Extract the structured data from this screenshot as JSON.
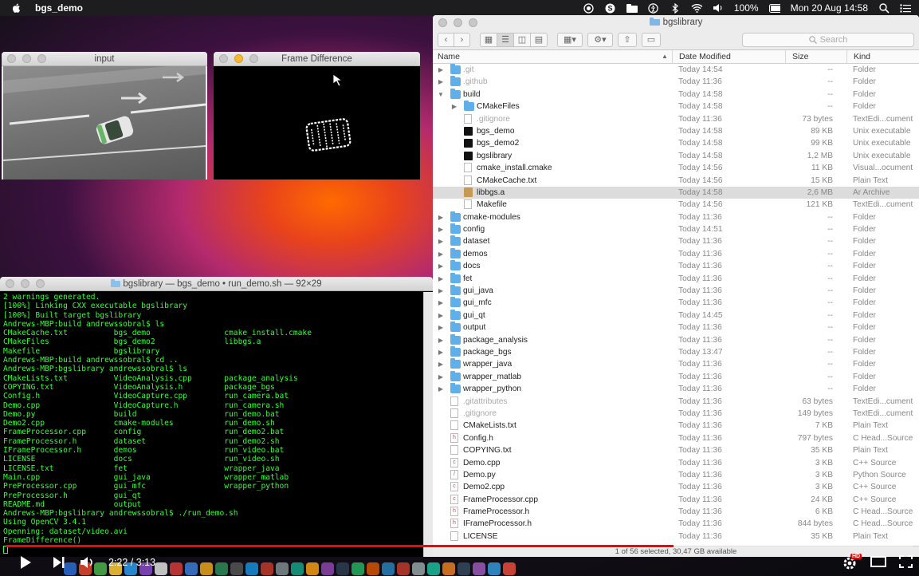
{
  "menubar": {
    "app_name": "bgs_demo",
    "battery": "100%",
    "datetime": "Mon 20 Aug  14:58"
  },
  "input_window": {
    "title": "input"
  },
  "frame_window": {
    "title": "Frame Difference"
  },
  "terminal": {
    "title": "bgslibrary — bgs_demo • run_demo.sh — 92×29",
    "lines": [
      "2 warnings generated.",
      "[100%] Linking CXX executable bgslibrary",
      "[100%] Built target bgslibrary",
      "Andrews-MBP:build andrewssobral$ ls",
      "CMakeCache.txt          bgs_demo                cmake_install.cmake",
      "CMakeFiles              bgs_demo2               libbgs.a",
      "Makefile                bgslibrary",
      "Andrews-MBP:build andrewssobral$ cd ..",
      "Andrews-MBP:bgslibrary andrewssobral$ ls",
      "CMakeLists.txt          VideoAnalysis.cpp       package_analysis",
      "COPYING.txt             VideoAnalysis.h         package_bgs",
      "Config.h                VideoCapture.cpp        run_camera.bat",
      "Demo.cpp                VideoCapture.h          run_camera.sh",
      "Demo.py                 build                   run_demo.bat",
      "Demo2.cpp               cmake-modules           run_demo.sh",
      "FrameProcessor.cpp      config                  run_demo2.bat",
      "FrameProcessor.h        dataset                 run_demo2.sh",
      "IFrameProcessor.h       demos                   run_video.bat",
      "LICENSE                 docs                    run_video.sh",
      "LICENSE.txt             fet                     wrapper_java",
      "Main.cpp                gui_java                wrapper_matlab",
      "PreProcessor.cpp        gui_mfc                 wrapper_python",
      "PreProcessor.h          gui_qt",
      "README.md               output",
      "Andrews-MBP:bgslibrary andrewssobral$ ./run_demo.sh",
      "Using OpenCV 3.4.1",
      "Openning: dataset/video.avi",
      "FrameDifference()"
    ]
  },
  "finder": {
    "title": "bgslibrary",
    "search_placeholder": "Search",
    "columns": {
      "name": "Name",
      "date": "Date Modified",
      "size": "Size",
      "kind": "Kind"
    },
    "rows": [
      {
        "name": ".git",
        "date": "Today 14:54",
        "size": "--",
        "kind": "Folder",
        "icon": "folder",
        "indent": 0,
        "expand": "closed",
        "dim": true
      },
      {
        "name": ".github",
        "date": "Today 11:36",
        "size": "--",
        "kind": "Folder",
        "icon": "folder",
        "indent": 0,
        "expand": "closed",
        "dim": true
      },
      {
        "name": "build",
        "date": "Today 14:58",
        "size": "--",
        "kind": "Folder",
        "icon": "folder",
        "indent": 0,
        "expand": "open"
      },
      {
        "name": "CMakeFiles",
        "date": "Today 14:58",
        "size": "--",
        "kind": "Folder",
        "icon": "folder",
        "indent": 1,
        "expand": "closed"
      },
      {
        "name": ".gitignore",
        "date": "Today 11:36",
        "size": "73 bytes",
        "kind": "TextEdi...cument",
        "icon": "doc",
        "indent": 1,
        "dim": true
      },
      {
        "name": "bgs_demo",
        "date": "Today 14:58",
        "size": "89 KB",
        "kind": "Unix executable",
        "icon": "exe",
        "indent": 1
      },
      {
        "name": "bgs_demo2",
        "date": "Today 14:58",
        "size": "99 KB",
        "kind": "Unix executable",
        "icon": "exe",
        "indent": 1
      },
      {
        "name": "bgslibrary",
        "date": "Today 14:58",
        "size": "1,2 MB",
        "kind": "Unix executable",
        "icon": "exe",
        "indent": 1
      },
      {
        "name": "cmake_install.cmake",
        "date": "Today 14:56",
        "size": "11 KB",
        "kind": "Visual...ocument",
        "icon": "doc",
        "indent": 1
      },
      {
        "name": "CMakeCache.txt",
        "date": "Today 14:56",
        "size": "15 KB",
        "kind": "Plain Text",
        "icon": "doc",
        "indent": 1
      },
      {
        "name": "libbgs.a",
        "date": "Today 14:58",
        "size": "2,6 MB",
        "kind": "Ar Archive",
        "icon": "archive",
        "indent": 1,
        "selected": true
      },
      {
        "name": "Makefile",
        "date": "Today 14:56",
        "size": "121 KB",
        "kind": "TextEdi...cument",
        "icon": "doc",
        "indent": 1
      },
      {
        "name": "cmake-modules",
        "date": "Today 11:36",
        "size": "--",
        "kind": "Folder",
        "icon": "folder",
        "indent": 0,
        "expand": "closed"
      },
      {
        "name": "config",
        "date": "Today 14:51",
        "size": "--",
        "kind": "Folder",
        "icon": "folder",
        "indent": 0,
        "expand": "closed"
      },
      {
        "name": "dataset",
        "date": "Today 11:36",
        "size": "--",
        "kind": "Folder",
        "icon": "folder",
        "indent": 0,
        "expand": "closed"
      },
      {
        "name": "demos",
        "date": "Today 11:36",
        "size": "--",
        "kind": "Folder",
        "icon": "folder",
        "indent": 0,
        "expand": "closed"
      },
      {
        "name": "docs",
        "date": "Today 11:36",
        "size": "--",
        "kind": "Folder",
        "icon": "folder",
        "indent": 0,
        "expand": "closed"
      },
      {
        "name": "fet",
        "date": "Today 11:36",
        "size": "--",
        "kind": "Folder",
        "icon": "folder",
        "indent": 0,
        "expand": "closed"
      },
      {
        "name": "gui_java",
        "date": "Today 11:36",
        "size": "--",
        "kind": "Folder",
        "icon": "folder",
        "indent": 0,
        "expand": "closed"
      },
      {
        "name": "gui_mfc",
        "date": "Today 11:36",
        "size": "--",
        "kind": "Folder",
        "icon": "folder",
        "indent": 0,
        "expand": "closed"
      },
      {
        "name": "gui_qt",
        "date": "Today 14:45",
        "size": "--",
        "kind": "Folder",
        "icon": "folder",
        "indent": 0,
        "expand": "closed"
      },
      {
        "name": "output",
        "date": "Today 11:36",
        "size": "--",
        "kind": "Folder",
        "icon": "folder",
        "indent": 0,
        "expand": "closed"
      },
      {
        "name": "package_analysis",
        "date": "Today 11:36",
        "size": "--",
        "kind": "Folder",
        "icon": "folder",
        "indent": 0,
        "expand": "closed"
      },
      {
        "name": "package_bgs",
        "date": "Today 13:47",
        "size": "--",
        "kind": "Folder",
        "icon": "folder",
        "indent": 0,
        "expand": "closed"
      },
      {
        "name": "wrapper_java",
        "date": "Today 11:36",
        "size": "--",
        "kind": "Folder",
        "icon": "folder",
        "indent": 0,
        "expand": "closed"
      },
      {
        "name": "wrapper_matlab",
        "date": "Today 11:36",
        "size": "--",
        "kind": "Folder",
        "icon": "folder",
        "indent": 0,
        "expand": "closed"
      },
      {
        "name": "wrapper_python",
        "date": "Today 11:36",
        "size": "--",
        "kind": "Folder",
        "icon": "folder",
        "indent": 0,
        "expand": "closed"
      },
      {
        "name": ".gitattributes",
        "date": "Today 11:36",
        "size": "63 bytes",
        "kind": "TextEdi...cument",
        "icon": "doc",
        "indent": 0,
        "dim": true
      },
      {
        "name": ".gitignore",
        "date": "Today 11:36",
        "size": "149 bytes",
        "kind": "TextEdi...cument",
        "icon": "doc",
        "indent": 0,
        "dim": true
      },
      {
        "name": "CMakeLists.txt",
        "date": "Today 11:36",
        "size": "7 KB",
        "kind": "Plain Text",
        "icon": "doc",
        "indent": 0
      },
      {
        "name": "Config.h",
        "date": "Today 11:36",
        "size": "797 bytes",
        "kind": "C Head...Source",
        "icon": "src-h",
        "indent": 0
      },
      {
        "name": "COPYING.txt",
        "date": "Today 11:36",
        "size": "35 KB",
        "kind": "Plain Text",
        "icon": "doc",
        "indent": 0
      },
      {
        "name": "Demo.cpp",
        "date": "Today 11:36",
        "size": "3 KB",
        "kind": "C++ Source",
        "icon": "src-cpp",
        "indent": 0
      },
      {
        "name": "Demo.py",
        "date": "Today 11:36",
        "size": "3 KB",
        "kind": "Python Source",
        "icon": "src-py",
        "indent": 0
      },
      {
        "name": "Demo2.cpp",
        "date": "Today 11:36",
        "size": "3 KB",
        "kind": "C++ Source",
        "icon": "src-cpp",
        "indent": 0
      },
      {
        "name": "FrameProcessor.cpp",
        "date": "Today 11:36",
        "size": "24 KB",
        "kind": "C++ Source",
        "icon": "src-cpp",
        "indent": 0
      },
      {
        "name": "FrameProcessor.h",
        "date": "Today 11:36",
        "size": "6 KB",
        "kind": "C Head...Source",
        "icon": "src-h",
        "indent": 0
      },
      {
        "name": "IFrameProcessor.h",
        "date": "Today 11:36",
        "size": "844 bytes",
        "kind": "C Head...Source",
        "icon": "src-h",
        "indent": 0
      },
      {
        "name": "LICENSE",
        "date": "Today 11:36",
        "size": "35 KB",
        "kind": "Plain Text",
        "icon": "doc",
        "indent": 0
      }
    ],
    "status": "1 of 56 selected, 30,47 GB available"
  },
  "player": {
    "time": "2:22 / 3:13",
    "progress_fraction": 0.736,
    "hd_badge": "HD"
  }
}
